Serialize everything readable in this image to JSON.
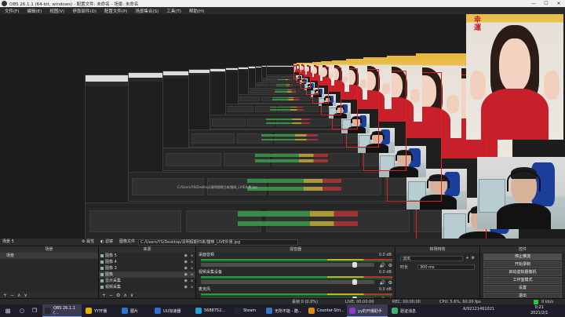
{
  "window": {
    "title": "OBS 26.1.1 (64-bit, windows) - 配置文件: 未命名 - 场景: 未命名",
    "controls": [
      "—",
      "☐",
      "✕"
    ]
  },
  "menu": [
    "文件(F)",
    "编辑(E)",
    "视图(V)",
    "停靠部件(D)",
    "配置文件(P)",
    "场景集合(S)",
    "工具(T)",
    "帮助(H)"
  ],
  "preview": {
    "nested_path": "C:/Users/YS/Desktop/清明假期归来/猫咪_LIVE外景.jpg",
    "charm_text": "幸\n運"
  },
  "docks": {
    "scenes": {
      "title": "场景 5",
      "rows": [
        "场景"
      ],
      "footer": [
        "+",
        "−",
        "∧",
        "∨"
      ]
    },
    "sources": {
      "title": "来源",
      "rows": [
        "图像 5",
        "图像 4",
        "图像 3",
        "图像",
        "显示采集",
        "视频采集"
      ],
      "selected_index": 3,
      "footer": [
        "+",
        "−",
        "⚙",
        "∧",
        "∨"
      ]
    },
    "file_path": {
      "label": "图像文件",
      "value": "C:/Users/YS/Desktop/清明假期归来/猫咪_LIVE外景.jpg"
    },
    "filter_btn": "滤镜",
    "props_btn": "属性",
    "mixer": {
      "title": "混音器",
      "channels": [
        {
          "name": "桌面音频",
          "db": "0.0 dB",
          "level": 0.9
        },
        {
          "name": "视频采集设备",
          "db": "0.0 dB",
          "level": 0.9
        },
        {
          "name": "麦克风",
          "db": "0.0 dB",
          "level": 0.9
        }
      ]
    },
    "transition": {
      "title": "转场特效",
      "type": "淡出",
      "duration_label": "时长",
      "duration": "300 ms"
    },
    "controls": {
      "title": "控件",
      "buttons": [
        "停止推流",
        "开始录制",
        "启动虚拟摄像机",
        "工作室模式",
        "设置",
        "退出"
      ]
    }
  },
  "status": {
    "dropped": "丢帧 0 (0.0%)",
    "live": "LIVE: 00:00:00",
    "rec": "REC: 00:00:00",
    "cpu": "CPU: 5.6%, 60.00 fps",
    "kbps": "0 kb/s"
  },
  "taskbar": {
    "items": [
      "OBS 26.1.1 (...",
      "YY开播",
      "图片",
      "UU加速器",
      "5688752...",
      "Steam",
      "无所不能 - 酷...",
      "Counter-Stri...",
      "yy的开播助手",
      "验证消息"
    ],
    "clock_time": "0:21",
    "clock_date": "2021/2/1",
    "tray_text": "A/92121461021"
  }
}
